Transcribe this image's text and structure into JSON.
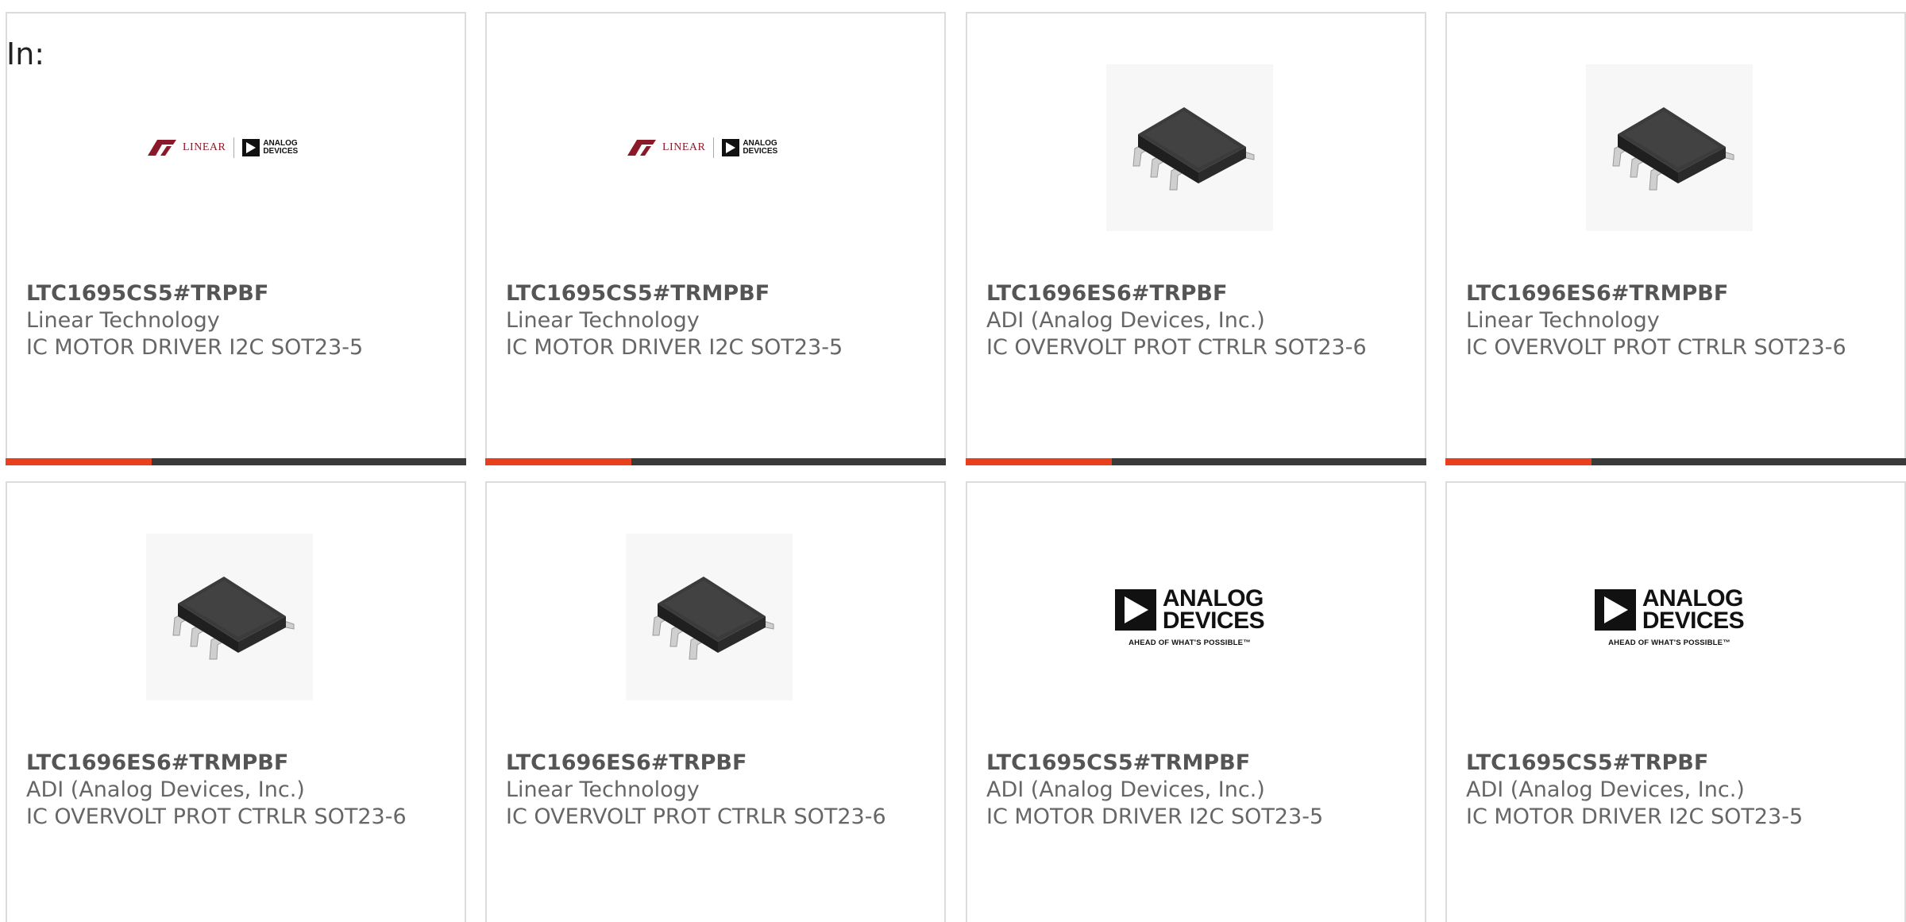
{
  "prefix_label": "In:",
  "colors": {
    "accent": "#e8401c",
    "bar": "#3a3a3a",
    "card_border": "#dcdcdc",
    "text": "#666666",
    "chip": "#2b2b2b",
    "linear_logo": "#8a1a2a"
  },
  "cards": [
    {
      "part_number": "LTC1695CS5#TRPBF",
      "manufacturer": "Linear Technology",
      "description": "IC MOTOR DRIVER I2C SOT23-5",
      "image": "linear-analog-logo",
      "logo_text_left": "LINEAR",
      "logo_text_right_1": "ANALOG",
      "logo_text_right_2": "DEVICES"
    },
    {
      "part_number": "LTC1695CS5#TRMPBF",
      "manufacturer": "Linear Technology",
      "description": "IC MOTOR DRIVER I2C SOT23-5",
      "image": "linear-analog-logo",
      "logo_text_left": "LINEAR",
      "logo_text_right_1": "ANALOG",
      "logo_text_right_2": "DEVICES"
    },
    {
      "part_number": "LTC1696ES6#TRPBF",
      "manufacturer": "ADI (Analog Devices, Inc.)",
      "description": "IC OVERVOLT PROT CTRLR SOT23-6",
      "image": "sot23-chip-icon"
    },
    {
      "part_number": "LTC1696ES6#TRMPBF",
      "manufacturer": "Linear Technology",
      "description": "IC OVERVOLT PROT CTRLR SOT23-6",
      "image": "sot23-chip-icon"
    },
    {
      "part_number": "LTC1696ES6#TRMPBF",
      "manufacturer": "ADI (Analog Devices, Inc.)",
      "description": "IC OVERVOLT PROT CTRLR SOT23-6",
      "image": "sot23-chip-icon"
    },
    {
      "part_number": "LTC1696ES6#TRPBF",
      "manufacturer": "Linear Technology",
      "description": "IC OVERVOLT PROT CTRLR SOT23-6",
      "image": "sot23-chip-icon"
    },
    {
      "part_number": "LTC1695CS5#TRMPBF",
      "manufacturer": "ADI (Analog Devices, Inc.)",
      "description": "IC MOTOR DRIVER I2C SOT23-5",
      "image": "analog-devices-logo",
      "logo_text_1": "ANALOG",
      "logo_text_2": "DEVICES",
      "logo_tagline": "AHEAD OF WHAT'S POSSIBLE™"
    },
    {
      "part_number": "LTC1695CS5#TRPBF",
      "manufacturer": "ADI (Analog Devices, Inc.)",
      "description": "IC MOTOR DRIVER I2C SOT23-5",
      "image": "analog-devices-logo",
      "logo_text_1": "ANALOG",
      "logo_text_2": "DEVICES",
      "logo_tagline": "AHEAD OF WHAT'S POSSIBLE™"
    }
  ]
}
